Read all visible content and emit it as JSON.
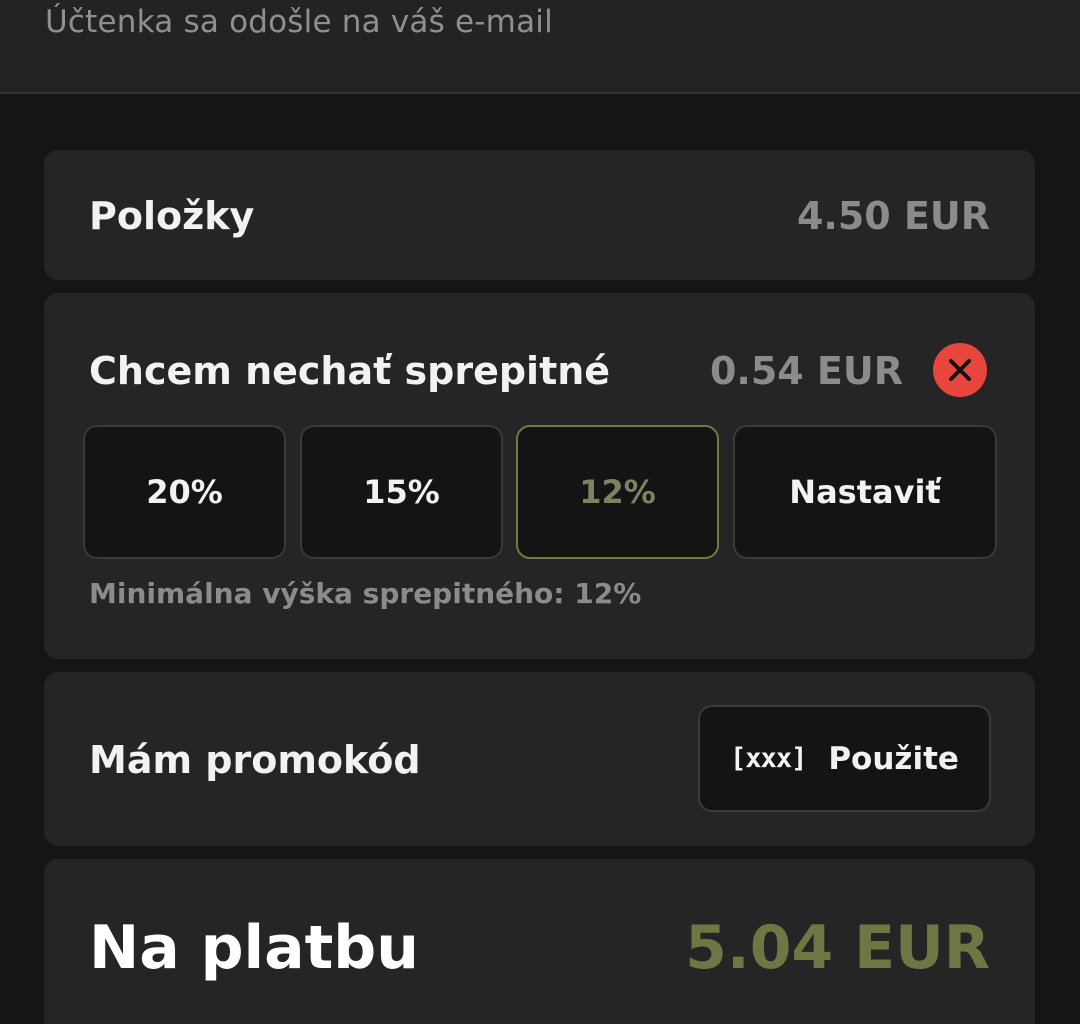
{
  "header": {
    "receipt_note": "Účtenka sa odošle na váš e-mail"
  },
  "items": {
    "label": "Položky",
    "amount": "4.50 EUR"
  },
  "tip": {
    "label": "Chcem nechať sprepitné",
    "amount": "0.54 EUR",
    "remove_icon": "close-icon",
    "remove_color": "#e8453c",
    "options": [
      {
        "label": "20%"
      },
      {
        "label": "15%"
      },
      {
        "label": "12%",
        "selected": true
      },
      {
        "label": "Nastaviť"
      }
    ],
    "minimum_note": "Minimálna výška sprepitného: 12%"
  },
  "promo": {
    "label": "Mám promokód",
    "button_icon": "[xxx]",
    "button_label": "Použite"
  },
  "total": {
    "label": "Na platbu",
    "amount": "5.04 EUR",
    "accent_color": "#6e7744"
  }
}
